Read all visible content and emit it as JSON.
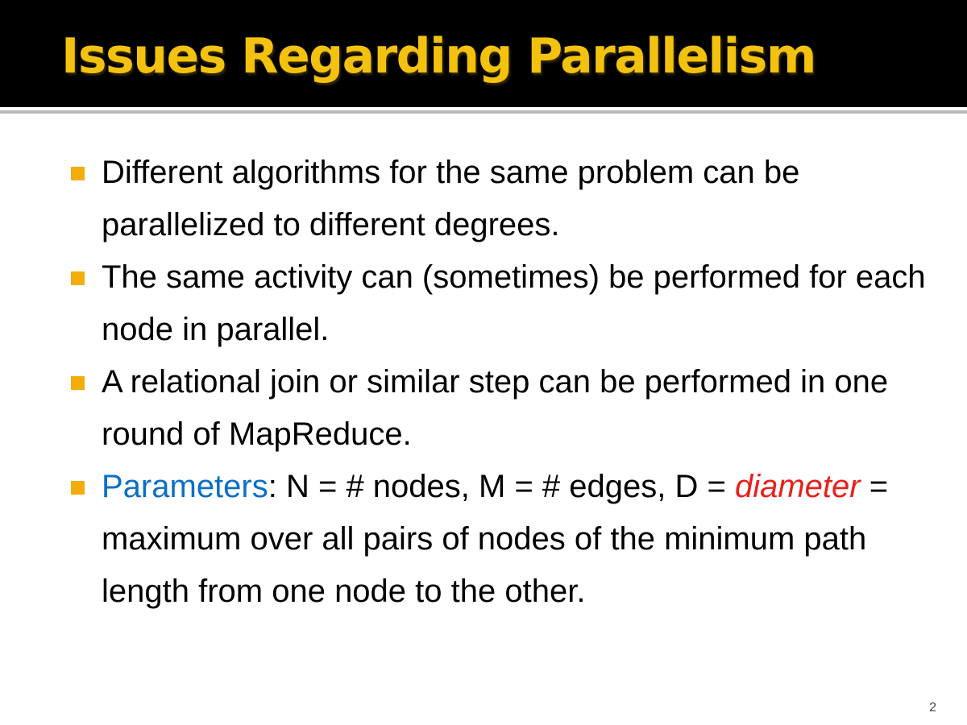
{
  "slide": {
    "title": "Issues Regarding Parallelism",
    "page_number": "2",
    "bullets": [
      {
        "text": "Different algorithms for the same problem can be parallelized to different degrees."
      },
      {
        "text": "The same activity can (sometimes) be performed for each node in parallel."
      },
      {
        "text": "A relational join or similar step can be performed in one round of MapReduce."
      },
      {
        "term": "Parameters",
        "text_after_term": ": N = # nodes, M = # edges, D = ",
        "term2": "diameter",
        "text_after_term2": " = maximum over all pairs of nodes of the minimum path length from one node to the other."
      }
    ]
  },
  "colors": {
    "title_bar": "#000000",
    "title_text": "#f3c20e",
    "bullet_marker": "#f3ad0b",
    "term_blue": "#0b6fc7",
    "term_red": "#e8201b"
  }
}
